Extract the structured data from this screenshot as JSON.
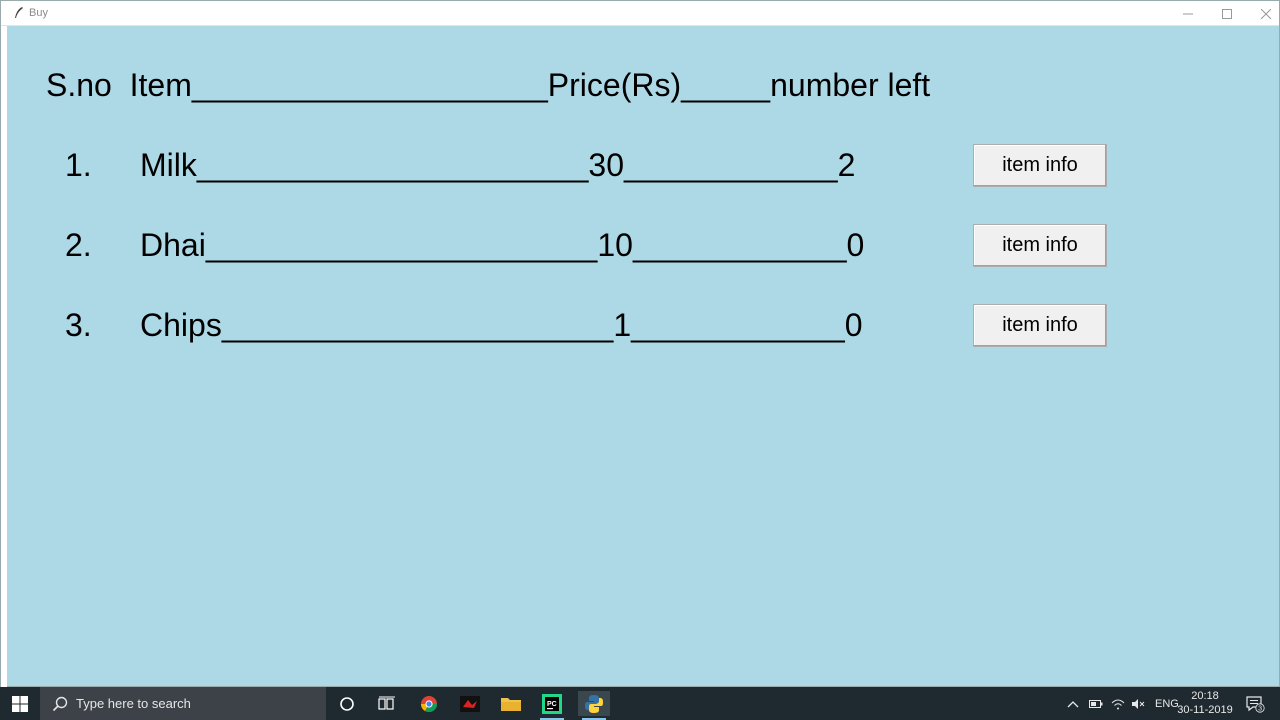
{
  "window": {
    "title": "Buy"
  },
  "header": {
    "text": "S.no  Item____________________Price(Rs)_____number left"
  },
  "items": [
    {
      "sno": "1.",
      "line": "Milk______________________30____________2",
      "button": "item info"
    },
    {
      "sno": "2.",
      "line": "Dhai______________________10____________0",
      "button": "item info"
    },
    {
      "sno": "3.",
      "line": "Chips______________________1____________0",
      "button": "item info"
    }
  ],
  "taskbar": {
    "search_placeholder": "Type here to search",
    "tray_language": "ENG",
    "clock_time": "20:18",
    "clock_date": "30-11-2019",
    "notification_count": "3",
    "icons": [
      "windows-start-icon",
      "search-icon",
      "cortana-icon",
      "task-view-icon",
      "chrome-icon",
      "game-app-icon",
      "file-explorer-icon",
      "pycharm-icon",
      "python-icon"
    ]
  },
  "colors": {
    "window_background": "#add8e6",
    "taskbar": "#1f2a30",
    "button_face": "#f0f0f0"
  }
}
